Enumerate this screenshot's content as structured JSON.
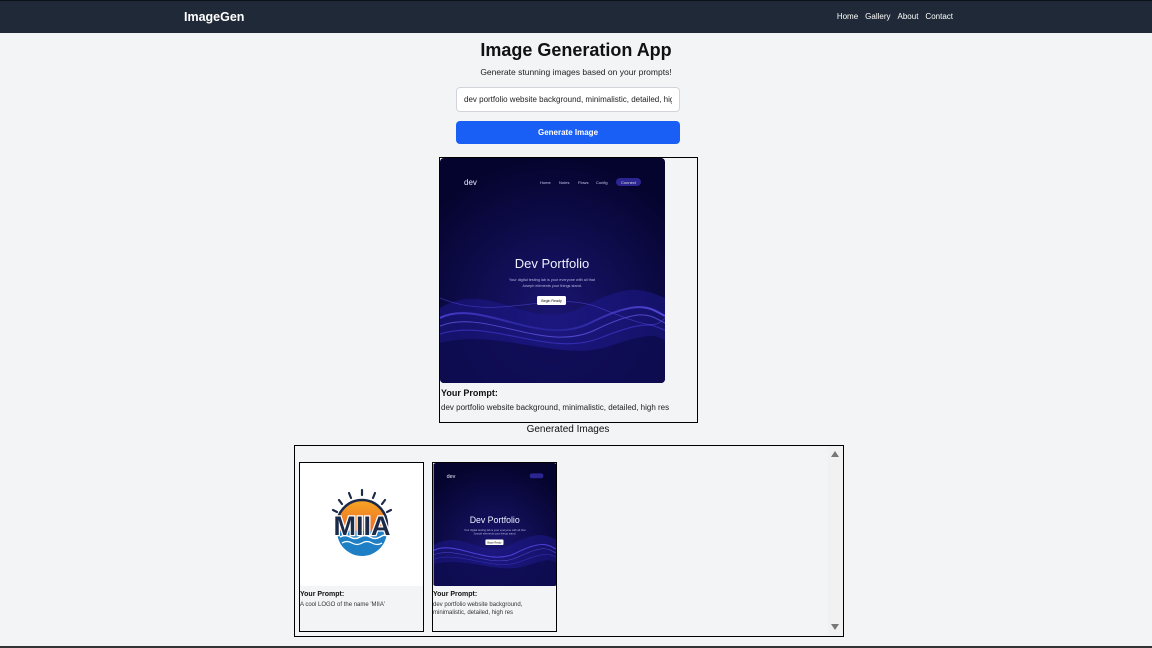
{
  "navbar": {
    "brand": "ImageGen",
    "links": [
      "Home",
      "Gallery",
      "About",
      "Contact"
    ]
  },
  "main": {
    "title": "Image Generation App",
    "subtitle": "Generate stunning images based on your prompts!",
    "prompt_value": "dev portfolio website background, minimalistic, detailed, high res",
    "generate_label": "Generate Image"
  },
  "result": {
    "image_logo": "dev",
    "image_nav": [
      "Home",
      "Notes",
      "Flows",
      "Config"
    ],
    "image_nav_button": "Connect",
    "image_heading": "Dev Portfolio",
    "image_text_line1": "Your digital testing lab is your everyone with all that",
    "image_text_line2": "Joseph elements your things stand.",
    "image_button": "Begin Ready",
    "label": "Your Prompt:",
    "text": "dev portfolio website background, minimalistic, detailed, high res"
  },
  "gallery": {
    "heading": "Generated Images",
    "items": [
      {
        "logo_text": "MIIA",
        "label": "Your Prompt:",
        "text": "A cool LOGO of the name 'MIIA'"
      },
      {
        "image_logo": "dev",
        "image_heading": "Dev Portfolio",
        "image_text_line1": "Your digital testing lab is your everyone with all that",
        "image_text_line2": "Joseph elements your things stand.",
        "image_button": "Begin Ready",
        "label": "Your Prompt:",
        "text": "dev portfolio website background, minimalistic, detailed, high res"
      }
    ]
  },
  "colors": {
    "navbar_bg": "#1f2937",
    "page_bg": "#f3f4f6",
    "primary_button": "#1a5ff5",
    "image_bg": "#06053a"
  }
}
